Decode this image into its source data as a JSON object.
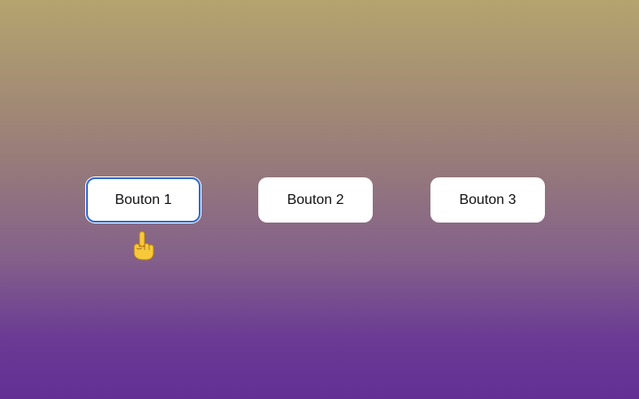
{
  "buttons": [
    {
      "label": "Bouton 1",
      "focused": true
    },
    {
      "label": "Bouton 2",
      "focused": false
    },
    {
      "label": "Bouton 3",
      "focused": false
    }
  ],
  "pointer": {
    "icon": "pointing-up-hand-icon"
  },
  "colors": {
    "background_top": "#b5a46e",
    "background_bottom": "#632f95",
    "button_bg": "#ffffff",
    "focus_ring": "#2f6bd0"
  }
}
